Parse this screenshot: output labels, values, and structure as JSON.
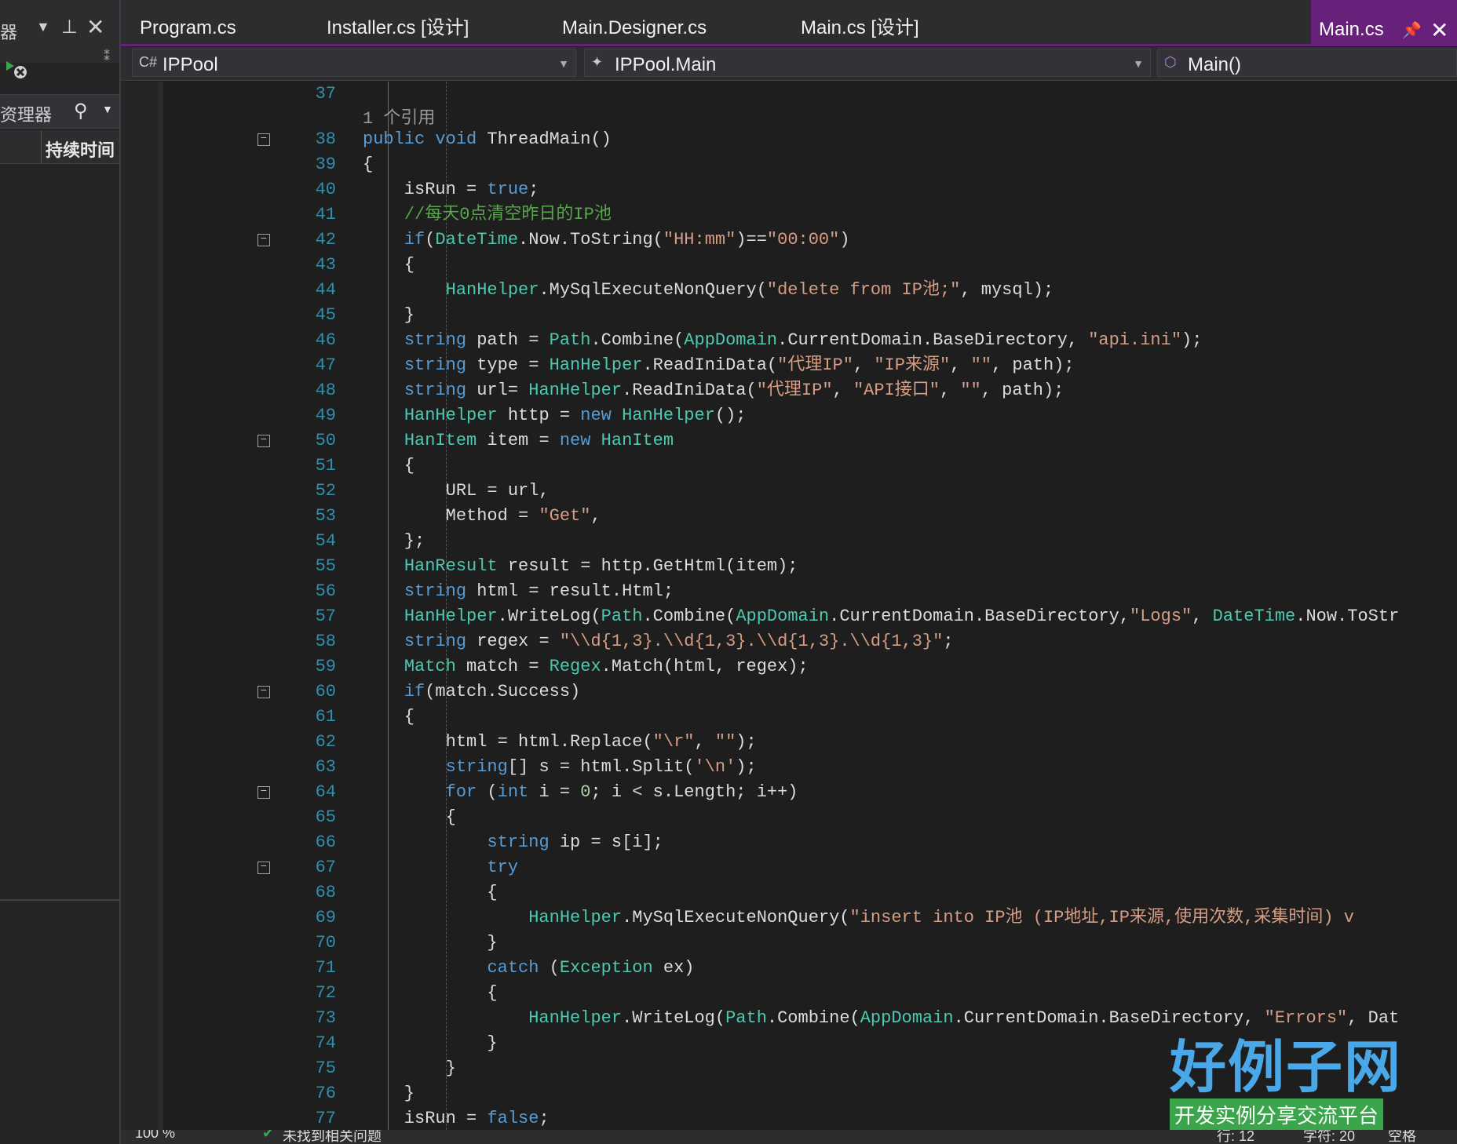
{
  "left_panel": {
    "title": "器",
    "search_label": "资理器",
    "column_header": "持续时间"
  },
  "tabs": [
    {
      "label": "Program.cs",
      "active": false
    },
    {
      "label": "Installer.cs [设计]",
      "active": false
    },
    {
      "label": "Main.Designer.cs",
      "active": false
    },
    {
      "label": "Main.cs [设计]",
      "active": false
    },
    {
      "label": "Main.cs",
      "active": true
    }
  ],
  "navbar": {
    "project": "IPPool",
    "class": "IPPool.Main",
    "member": "Main()"
  },
  "editor": {
    "reference_hint": "1 个引用",
    "lines": [
      {
        "n": "37",
        "html": ""
      },
      {
        "n": "38",
        "html": "<span class=\"kw\">public void</span> ThreadMain()"
      },
      {
        "n": "39",
        "html": "{"
      },
      {
        "n": "40",
        "html": "    isRun = <span class=\"kw\">true</span>;"
      },
      {
        "n": "41",
        "html": "    <span class=\"cm\">//每天0点清空昨日的IP池</span>"
      },
      {
        "n": "42",
        "html": "    <span class=\"kw\">if</span>(<span class=\"ty\">DateTime</span>.Now.ToString(<span class=\"st\">\"HH:mm\"</span>)==<span class=\"st\">\"00:00\"</span>)"
      },
      {
        "n": "43",
        "html": "    {"
      },
      {
        "n": "44",
        "html": "        <span class=\"ty\">HanHelper</span>.MySqlExecuteNonQuery(<span class=\"st\">\"delete from IP池;\"</span>, mysql);"
      },
      {
        "n": "45",
        "html": "    }"
      },
      {
        "n": "46",
        "html": "    <span class=\"kw\">string</span> path = <span class=\"ty\">Path</span>.Combine(<span class=\"ty\">AppDomain</span>.CurrentDomain.BaseDirectory, <span class=\"st\">\"api.ini\"</span>);"
      },
      {
        "n": "47",
        "html": "    <span class=\"kw\">string</span> type = <span class=\"ty\">HanHelper</span>.ReadIniData(<span class=\"st\">\"代理IP\"</span>, <span class=\"st\">\"IP来源\"</span>, <span class=\"st\">\"\"</span>, path);"
      },
      {
        "n": "48",
        "html": "    <span class=\"kw\">string</span> url= <span class=\"ty\">HanHelper</span>.ReadIniData(<span class=\"st\">\"代理IP\"</span>, <span class=\"st\">\"API接口\"</span>, <span class=\"st\">\"\"</span>, path);"
      },
      {
        "n": "49",
        "html": "    <span class=\"ty\">HanHelper</span> http = <span class=\"kw\">new</span> <span class=\"ty\">HanHelper</span>();"
      },
      {
        "n": "50",
        "html": "    <span class=\"ty\">HanItem</span> item = <span class=\"kw\">new</span> <span class=\"ty\">HanItem</span>"
      },
      {
        "n": "51",
        "html": "    {"
      },
      {
        "n": "52",
        "html": "        URL = url,"
      },
      {
        "n": "53",
        "html": "        Method = <span class=\"st\">\"Get\"</span>,"
      },
      {
        "n": "54",
        "html": "    };"
      },
      {
        "n": "55",
        "html": "    <span class=\"ty\">HanResult</span> result = http.GetHtml(item);"
      },
      {
        "n": "56",
        "html": "    <span class=\"kw\">string</span> html = result.Html;"
      },
      {
        "n": "57",
        "html": "    <span class=\"ty\">HanHelper</span>.WriteLog(<span class=\"ty\">Path</span>.Combine(<span class=\"ty\">AppDomain</span>.CurrentDomain.BaseDirectory,<span class=\"st\">\"Logs\"</span>, <span class=\"ty\">DateTime</span>.Now.ToStr"
      },
      {
        "n": "58",
        "html": "    <span class=\"kw\">string</span> regex = <span class=\"st\">\"\\\\d{1,3}.\\\\d{1,3}.\\\\d{1,3}.\\\\d{1,3}\"</span>;"
      },
      {
        "n": "59",
        "html": "    <span class=\"ty\">Match</span> match = <span class=\"ty\">Regex</span>.Match(html, regex);"
      },
      {
        "n": "60",
        "html": "    <span class=\"kw\">if</span>(match.Success)"
      },
      {
        "n": "61",
        "html": "    {"
      },
      {
        "n": "62",
        "html": "        html = html.Replace(<span class=\"st\">\"\\r\"</span>, <span class=\"st\">\"\"</span>);"
      },
      {
        "n": "63",
        "html": "        <span class=\"kw\">string</span>[] s = html.Split(<span class=\"st\">'\\n'</span>);"
      },
      {
        "n": "64",
        "html": "        <span class=\"kw\">for</span> (<span class=\"kw\">int</span> i = <span class=\"nu\">0</span>; i &lt; s.Length; i++)"
      },
      {
        "n": "65",
        "html": "        {"
      },
      {
        "n": "66",
        "html": "            <span class=\"kw\">string</span> ip = s[i];"
      },
      {
        "n": "67",
        "html": "            <span class=\"kw\">try</span>"
      },
      {
        "n": "68",
        "html": "            {"
      },
      {
        "n": "69",
        "html": "                <span class=\"ty\">HanHelper</span>.MySqlExecuteNonQuery(<span class=\"st\">\"insert into IP池 (IP地址,IP来源,使用次数,采集时间) v</span>"
      },
      {
        "n": "70",
        "html": "            }"
      },
      {
        "n": "71",
        "html": "            <span class=\"kw\">catch</span> (<span class=\"ty\">Exception</span> ex)"
      },
      {
        "n": "72",
        "html": "            {"
      },
      {
        "n": "73",
        "html": "                <span class=\"ty\">HanHelper</span>.WriteLog(<span class=\"ty\">Path</span>.Combine(<span class=\"ty\">AppDomain</span>.CurrentDomain.BaseDirectory, <span class=\"st\">\"Errors\"</span>, Dat"
      },
      {
        "n": "74",
        "html": "            }"
      },
      {
        "n": "75",
        "html": "        }"
      },
      {
        "n": "76",
        "html": "    }"
      },
      {
        "n": "77",
        "html": "    isRun = <span class=\"kw\">false</span>;"
      }
    ],
    "fold_lines": [
      "38",
      "42",
      "50",
      "60",
      "64",
      "67"
    ]
  },
  "statusbar": {
    "zoom": "100 %",
    "issues": "未找到相关问题",
    "line": "行: 12",
    "char": "字符: 20",
    "mode": "空格"
  },
  "watermark": {
    "big": "好例子网",
    "small": "开发实例分享交流平台"
  }
}
